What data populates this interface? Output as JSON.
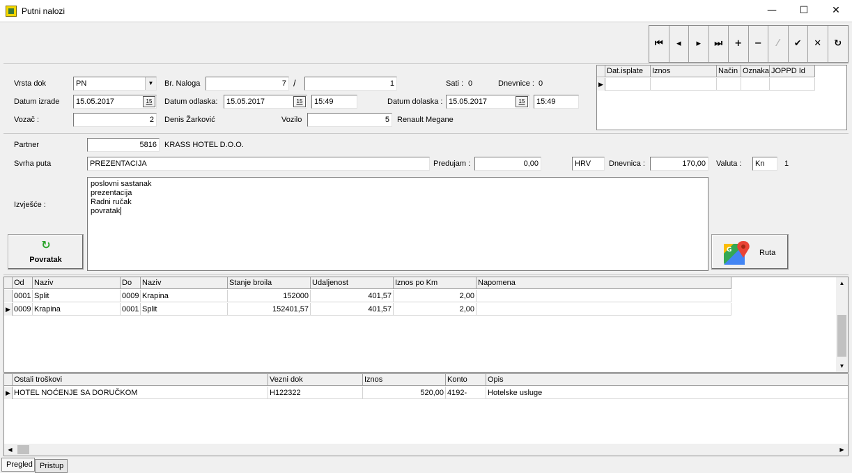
{
  "window": {
    "title": "Putni nalozi",
    "min_icon": "minimize-icon",
    "max_icon": "maximize-icon",
    "close_icon": "close-icon"
  },
  "nav": {
    "buttons": [
      {
        "name": "first",
        "glyph": "|◂"
      },
      {
        "name": "prior",
        "glyph": "◂"
      },
      {
        "name": "next",
        "glyph": "▸"
      },
      {
        "name": "last",
        "glyph": "▸|"
      },
      {
        "name": "insert",
        "glyph": "+"
      },
      {
        "name": "delete",
        "glyph": "−"
      },
      {
        "name": "edit",
        "glyph": "⁄"
      },
      {
        "name": "post",
        "glyph": "✔"
      },
      {
        "name": "cancel",
        "glyph": "✕"
      },
      {
        "name": "refresh",
        "glyph": "↻"
      }
    ]
  },
  "form": {
    "vrsta_dok_label": "Vrsta dok",
    "vrsta_dok_value": "PN",
    "br_naloga_label": "Br. Naloga",
    "br_naloga_value": "7",
    "br_naloga_sep": "/",
    "br_naloga_value2": "1",
    "sati_label": "Sati :",
    "sati_value": "0",
    "dnevnice_label": "Dnevnice :",
    "dnevnice_value": "0",
    "datum_izrade_label": "Datum izrade",
    "datum_izrade_value": "15.05.2017",
    "datum_odlaska_label": "Datum odlaska:",
    "datum_odlaska_value": "15.05.2017",
    "vrijeme_odlaska": "15:49",
    "datum_dolaska_label": "Datum dolaska :",
    "datum_dolaska_value": "15.05.2017",
    "vrijeme_dolaska": "15:49",
    "vozac_label": "Vozač :",
    "vozac_value": "2",
    "vozac_name": "Denis  Žarković",
    "vozilo_label": "Vozilo",
    "vozilo_value": "5",
    "vozilo_name": "Renault Megane",
    "partner_label": "Partner",
    "partner_value": "5816",
    "partner_name": "KRASS HOTEL D.O.O.",
    "svrha_label": "Svrha puta",
    "svrha_value": "PREZENTACIJA",
    "predujam_label": "Predujam :",
    "predujam_value": "0,00",
    "predujam_currency": "HRV",
    "dnevnica_label": "Dnevnica :",
    "dnevnica_value": "170,00",
    "valuta_label": "Valuta :",
    "valuta_value": "Kn",
    "valuta_rate": "1",
    "izvjesce_label": "Izvješće  :",
    "izvjesce_lines": [
      "poslovni sastanak",
      "prezentacija",
      "Radni ručak",
      "povratak"
    ]
  },
  "payments_grid": {
    "columns": [
      "Dat.isplate",
      "Iznos",
      "Način",
      "Oznaka",
      "JOPPD Id"
    ]
  },
  "buttons": {
    "povratak_label": "Povratak",
    "ruta_label": "Ruta"
  },
  "route_grid": {
    "columns": [
      "Od",
      "Naziv",
      "Do",
      "Naziv",
      "Stanje broila",
      "Udaljenost",
      "Iznos po Km",
      "Napomena"
    ],
    "rows": [
      [
        "0001",
        "Split",
        "0009",
        "Krapina",
        "152000",
        "401,57",
        "2,00",
        ""
      ],
      [
        "0009",
        "Krapina",
        "0001",
        "Split",
        "152401,57",
        "401,57",
        "2,00",
        ""
      ]
    ]
  },
  "costs_grid": {
    "columns": [
      "Ostali troškovi",
      "Vezni dok",
      "Iznos",
      "Konto",
      "Opis"
    ],
    "rows": [
      [
        "HOTEL NOĆENJE SA DORUČKOM",
        "H122322",
        "520,00",
        "4192-",
        "Hotelske usluge"
      ]
    ]
  },
  "tabs": [
    "Pregled",
    "Pristup"
  ]
}
